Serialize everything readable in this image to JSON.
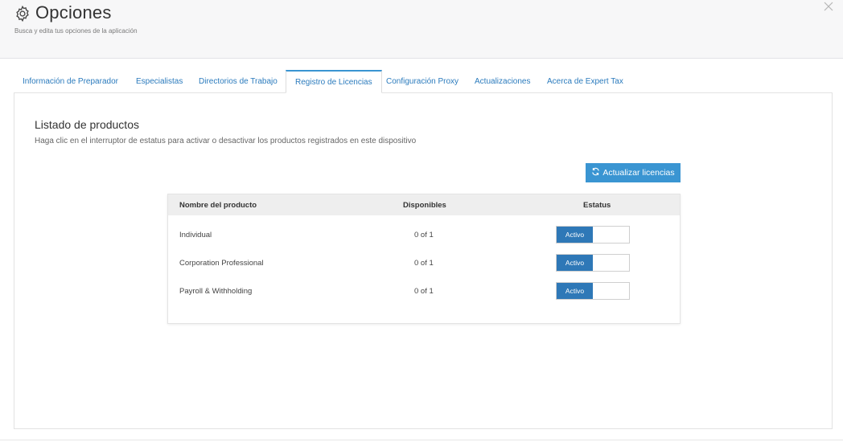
{
  "header": {
    "title": "Opciones",
    "subtitle": "Busca y edita tus opciones de la aplicación",
    "icon": "gear-icon",
    "close_icon": "close-icon"
  },
  "tabs": [
    {
      "label": "Información de Preparador",
      "active": false
    },
    {
      "label": "Especialistas",
      "active": false
    },
    {
      "label": "Directorios de Trabajo",
      "active": false
    },
    {
      "label": "Registro de Licencias",
      "active": true
    },
    {
      "label": "Configuración Proxy",
      "active": false
    },
    {
      "label": "Actualizaciones",
      "active": false
    },
    {
      "label": "Acerca de Expert Tax",
      "active": false
    }
  ],
  "section": {
    "heading": "Listado de productos",
    "description": "Haga clic en el interruptor de estatus para activar o desactivar los productos registrados en este dispositivo",
    "refresh_button": "Actualizar licencias",
    "refresh_icon": "refresh-icon"
  },
  "table": {
    "columns": [
      "Nombre del producto",
      "Disponibles",
      "Estatus"
    ],
    "rows": [
      {
        "name": "Individual",
        "available": "0 of 1",
        "status": "Activo"
      },
      {
        "name": "Corporation Professional",
        "available": "0 of 1",
        "status": "Activo"
      },
      {
        "name": "Payroll & Withholding",
        "available": "0 of 1",
        "status": "Activo"
      }
    ]
  },
  "colors": {
    "accent": "#3a95d2",
    "toggle_on": "#2e78b7",
    "tab_text": "#2b7bbd",
    "header_bg": "#f7f7f8"
  }
}
